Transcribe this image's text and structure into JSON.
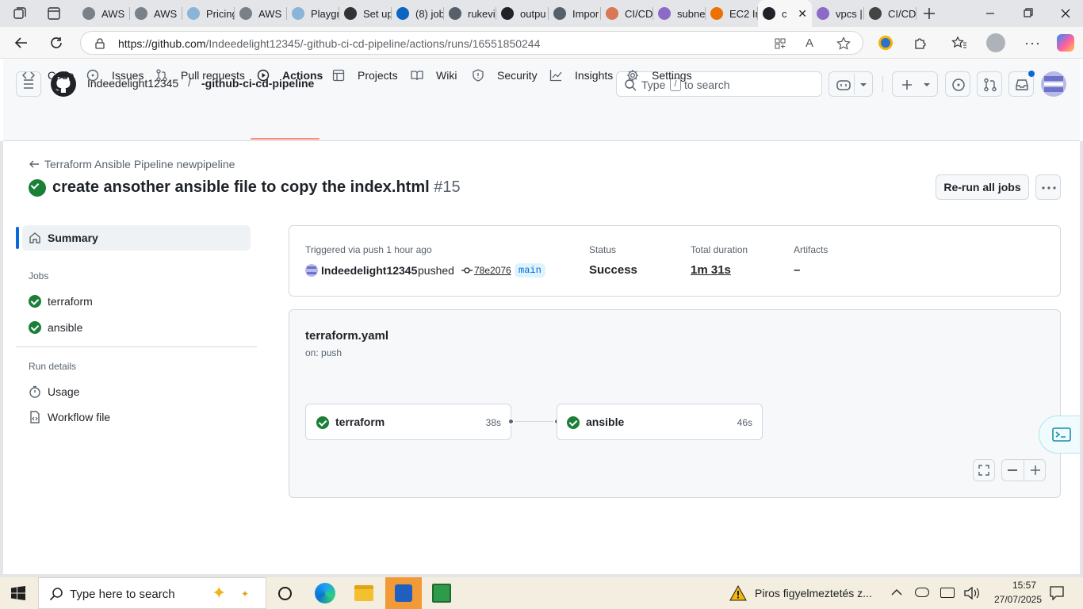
{
  "browser": {
    "tabs": [
      {
        "label": "AWS",
        "icon": "aws-icon",
        "color": "#7a8087"
      },
      {
        "label": "AWS",
        "icon": "aws-icon",
        "color": "#7a8087"
      },
      {
        "label": "Pricing",
        "icon": "cloud-icon",
        "color": "#8ab4d8"
      },
      {
        "label": "AWS",
        "icon": "aws-icon",
        "color": "#7a8087"
      },
      {
        "label": "Playgr",
        "icon": "cloud-icon",
        "color": "#8ab4d8"
      },
      {
        "label": "Set up",
        "icon": "openai-icon",
        "color": "#333333"
      },
      {
        "label": "(8) job",
        "icon": "linkedin-icon",
        "color": "#0a66c2"
      },
      {
        "label": "rukevi",
        "icon": "github-icon",
        "color": "#57606a"
      },
      {
        "label": "outpu",
        "icon": "github-icon",
        "color": "#1f2328"
      },
      {
        "label": "Impor",
        "icon": "github-icon",
        "color": "#57606a"
      },
      {
        "label": "CI/CD",
        "icon": "claude-icon",
        "color": "#d97757"
      },
      {
        "label": "subne",
        "icon": "vpc-icon",
        "color": "#8c6bc8"
      },
      {
        "label": "EC2 In",
        "icon": "ec2-icon",
        "color": "#ed7100"
      },
      {
        "label": "c",
        "icon": "github-icon",
        "color": "#1f2328"
      },
      {
        "label": "vpcs |",
        "icon": "vpc-icon",
        "color": "#8c6bc8"
      },
      {
        "label": "CI/CD",
        "icon": "globe-icon",
        "color": "#444444"
      }
    ],
    "url": "https://github.com/Indeedelight12345/-github-ci-cd-pipeline/actions/runs/16551850244",
    "url_host": "https://github.com",
    "url_path": "/Indeedelight12345/-github-ci-cd-pipeline/actions/runs/16551850244"
  },
  "github": {
    "owner": "Indeedelight12345",
    "separator": "/",
    "repo": "-github-ci-cd-pipeline",
    "search_text": "Type",
    "search_key": "/",
    "search_suffix": "to search",
    "nav": [
      {
        "label": "Code",
        "icon": "code-icon"
      },
      {
        "label": "Issues",
        "icon": "issue-icon"
      },
      {
        "label": "Pull requests",
        "icon": "pull-request-icon"
      },
      {
        "label": "Actions",
        "icon": "play-icon",
        "active": true
      },
      {
        "label": "Projects",
        "icon": "table-icon"
      },
      {
        "label": "Wiki",
        "icon": "book-icon"
      },
      {
        "label": "Security",
        "icon": "shield-icon"
      },
      {
        "label": "Insights",
        "icon": "graph-icon"
      },
      {
        "label": "Settings",
        "icon": "gear-icon"
      }
    ],
    "accent": "#fd8c73"
  },
  "run": {
    "back_link": "Terraform Ansible Pipeline newpipeline",
    "title": "create ansother ansible file to copy the index.html",
    "number": "#15",
    "rerun_label": "Re-run all jobs"
  },
  "sidebar": {
    "summary": "Summary",
    "jobs_heading": "Jobs",
    "jobs": [
      "terraform",
      "ansible"
    ],
    "details_heading": "Run details",
    "usage": "Usage",
    "workflow_file": "Workflow file"
  },
  "summary": {
    "trigger": "Triggered via push 1 hour ago",
    "actor": "Indeedelight12345",
    "action": "pushed",
    "commit": "78e2076",
    "branch": "main",
    "status_label": "Status",
    "status": "Success",
    "duration_label": "Total duration",
    "duration": "1m 31s",
    "artifacts_label": "Artifacts",
    "artifacts": "–"
  },
  "workflow": {
    "file": "terraform.yaml",
    "on": "on: push",
    "jobs": [
      {
        "name": "terraform",
        "time": "38s"
      },
      {
        "name": "ansible",
        "time": "46s"
      }
    ],
    "success_color": "#1a7f37"
  },
  "taskbar": {
    "search_placeholder": "Type here to search",
    "notification": "Piros figyelmeztetés z...",
    "time": "15:57",
    "date": "27/07/2025"
  }
}
